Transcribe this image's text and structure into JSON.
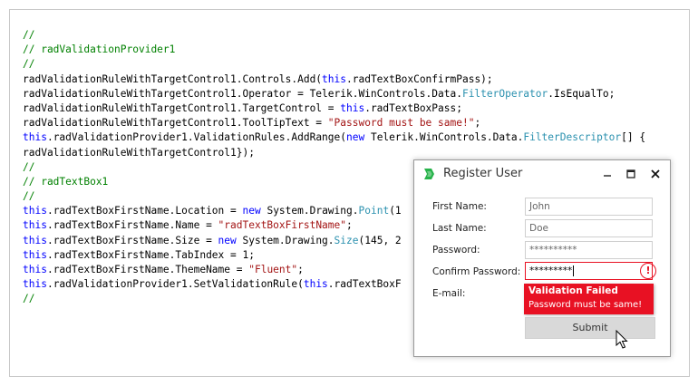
{
  "code": {
    "lines": [
      [
        {
          "t": "//",
          "c": "cmt"
        }
      ],
      [
        {
          "t": "// radValidationProvider1",
          "c": "cmt"
        }
      ],
      [
        {
          "t": "//",
          "c": "cmt"
        }
      ],
      [
        {
          "t": "radValidationRuleWithTargetControl1.Controls.Add(",
          "c": ""
        },
        {
          "t": "this",
          "c": "kw"
        },
        {
          "t": ".radTextBoxConfirmPass);",
          "c": ""
        }
      ],
      [
        {
          "t": "radValidationRuleWithTargetControl1.Operator = Telerik.WinControls.Data.",
          "c": ""
        },
        {
          "t": "FilterOperator",
          "c": "typ"
        },
        {
          "t": ".IsEqualTo;",
          "c": ""
        }
      ],
      [
        {
          "t": "radValidationRuleWithTargetControl1.TargetControl = ",
          "c": ""
        },
        {
          "t": "this",
          "c": "kw"
        },
        {
          "t": ".radTextBoxPass;",
          "c": ""
        }
      ],
      [
        {
          "t": "radValidationRuleWithTargetControl1.ToolTipText = ",
          "c": ""
        },
        {
          "t": "\"Password must be same!\"",
          "c": "str"
        },
        {
          "t": ";",
          "c": ""
        }
      ],
      [
        {
          "t": "this",
          "c": "kw"
        },
        {
          "t": ".radValidationProvider1.ValidationRules.AddRange(",
          "c": ""
        },
        {
          "t": "new",
          "c": "kw"
        },
        {
          "t": " Telerik.WinControls.Data.",
          "c": ""
        },
        {
          "t": "FilterDescriptor",
          "c": "typ"
        },
        {
          "t": "[] {",
          "c": ""
        }
      ],
      [
        {
          "t": "radValidationRuleWithTargetControl1});",
          "c": ""
        }
      ],
      [
        {
          "t": "//",
          "c": "cmt"
        }
      ],
      [
        {
          "t": "// radTextBox1",
          "c": "cmt"
        }
      ],
      [
        {
          "t": "//",
          "c": "cmt"
        }
      ],
      [
        {
          "t": "this",
          "c": "kw"
        },
        {
          "t": ".radTextBoxFirstName.Location = ",
          "c": ""
        },
        {
          "t": "new",
          "c": "kw"
        },
        {
          "t": " System.Drawing.",
          "c": ""
        },
        {
          "t": "Point",
          "c": "typ"
        },
        {
          "t": "(1",
          "c": ""
        }
      ],
      [
        {
          "t": "this",
          "c": "kw"
        },
        {
          "t": ".radTextBoxFirstName.Name = ",
          "c": ""
        },
        {
          "t": "\"radTextBoxFirstName\"",
          "c": "str"
        },
        {
          "t": ";",
          "c": ""
        }
      ],
      [
        {
          "t": "this",
          "c": "kw"
        },
        {
          "t": ".radTextBoxFirstName.Size = ",
          "c": ""
        },
        {
          "t": "new",
          "c": "kw"
        },
        {
          "t": " System.Drawing.",
          "c": ""
        },
        {
          "t": "Size",
          "c": "typ"
        },
        {
          "t": "(145, 2",
          "c": ""
        }
      ],
      [
        {
          "t": "this",
          "c": "kw"
        },
        {
          "t": ".radTextBoxFirstName.TabIndex = 1;",
          "c": ""
        }
      ],
      [
        {
          "t": "this",
          "c": "kw"
        },
        {
          "t": ".radTextBoxFirstName.ThemeName = ",
          "c": ""
        },
        {
          "t": "\"Fluent\"",
          "c": "str"
        },
        {
          "t": ";",
          "c": ""
        }
      ],
      [
        {
          "t": "this",
          "c": "kw"
        },
        {
          "t": ".radValidationProvider1.SetValidationRule(",
          "c": ""
        },
        {
          "t": "this",
          "c": "kw"
        },
        {
          "t": ".radTextBoxF",
          "c": ""
        }
      ],
      [
        {
          "t": "//",
          "c": "cmt"
        }
      ]
    ]
  },
  "dialog": {
    "title": "Register User",
    "icon": "telerik-app-icon",
    "controls": {
      "minimize": "minimize-icon",
      "maximize": "maximize-icon",
      "close": "close-icon"
    },
    "fields": [
      {
        "label": "First Name:",
        "value": "John"
      },
      {
        "label": "Last Name:",
        "value": "Doe"
      },
      {
        "label": "Password:",
        "value": "**********"
      },
      {
        "label": "Confirm Password:",
        "value": "*********"
      },
      {
        "label": "E-mail:",
        "value": ""
      }
    ],
    "tooltip": {
      "title": "Validation Failed",
      "text": "Password must be same!"
    },
    "error_icon": "!",
    "submit_label": "Submit"
  },
  "colors": {
    "comment": "#008000",
    "keyword": "#0000ff",
    "string": "#a31515",
    "type": "#2b91af",
    "error": "#e81123",
    "app_icon": "#27b34a"
  }
}
